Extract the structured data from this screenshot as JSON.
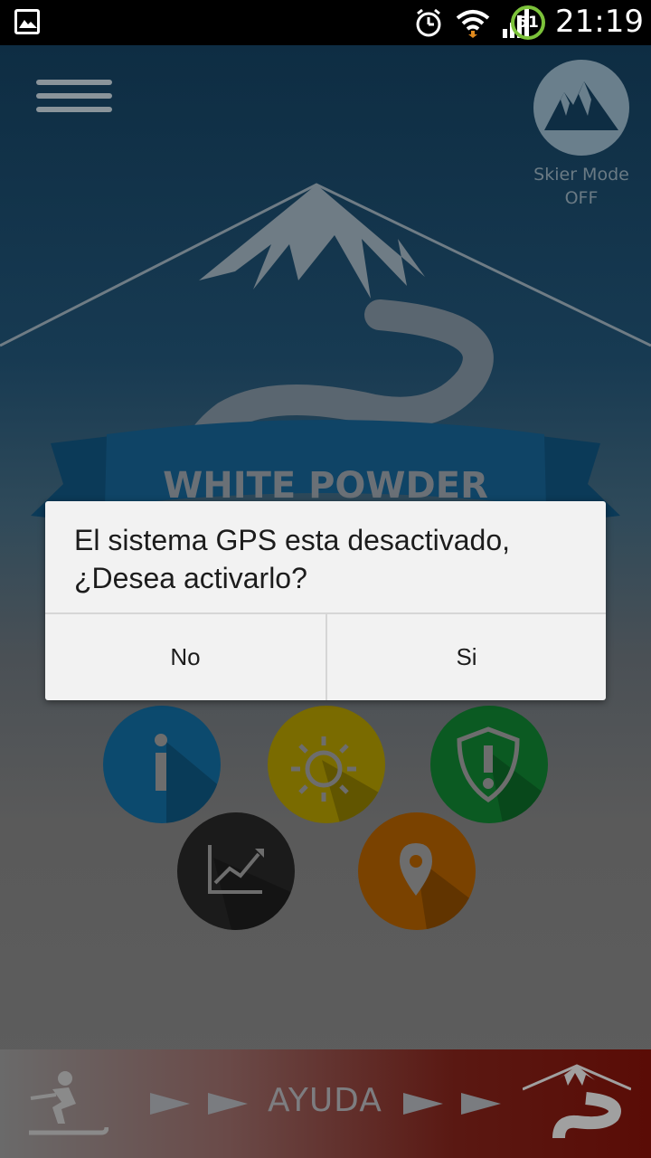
{
  "status_bar": {
    "battery_level": "51",
    "time": "21:19",
    "icons": [
      "gallery-notification-icon",
      "alarm-icon",
      "wifi-icon",
      "signal-icon",
      "battery-icon"
    ]
  },
  "app": {
    "skier_mode": {
      "line1": "Skier Mode",
      "line2": "OFF"
    },
    "logo_text": "WHITE POWDER",
    "buttons": [
      "info-icon",
      "weather-sun-icon",
      "alert-shield-icon",
      "stats-chart-icon",
      "map-pin-icon"
    ],
    "help_bar": {
      "label": "AYUDA"
    }
  },
  "dialog": {
    "message": "El sistema GPS esta desactivado, ¿Desea activarlo?",
    "button_no": "No",
    "button_yes": "Si"
  },
  "colors": {
    "battery_ring": "#7cc23a",
    "dialog_bg": "#f2f2f2"
  }
}
